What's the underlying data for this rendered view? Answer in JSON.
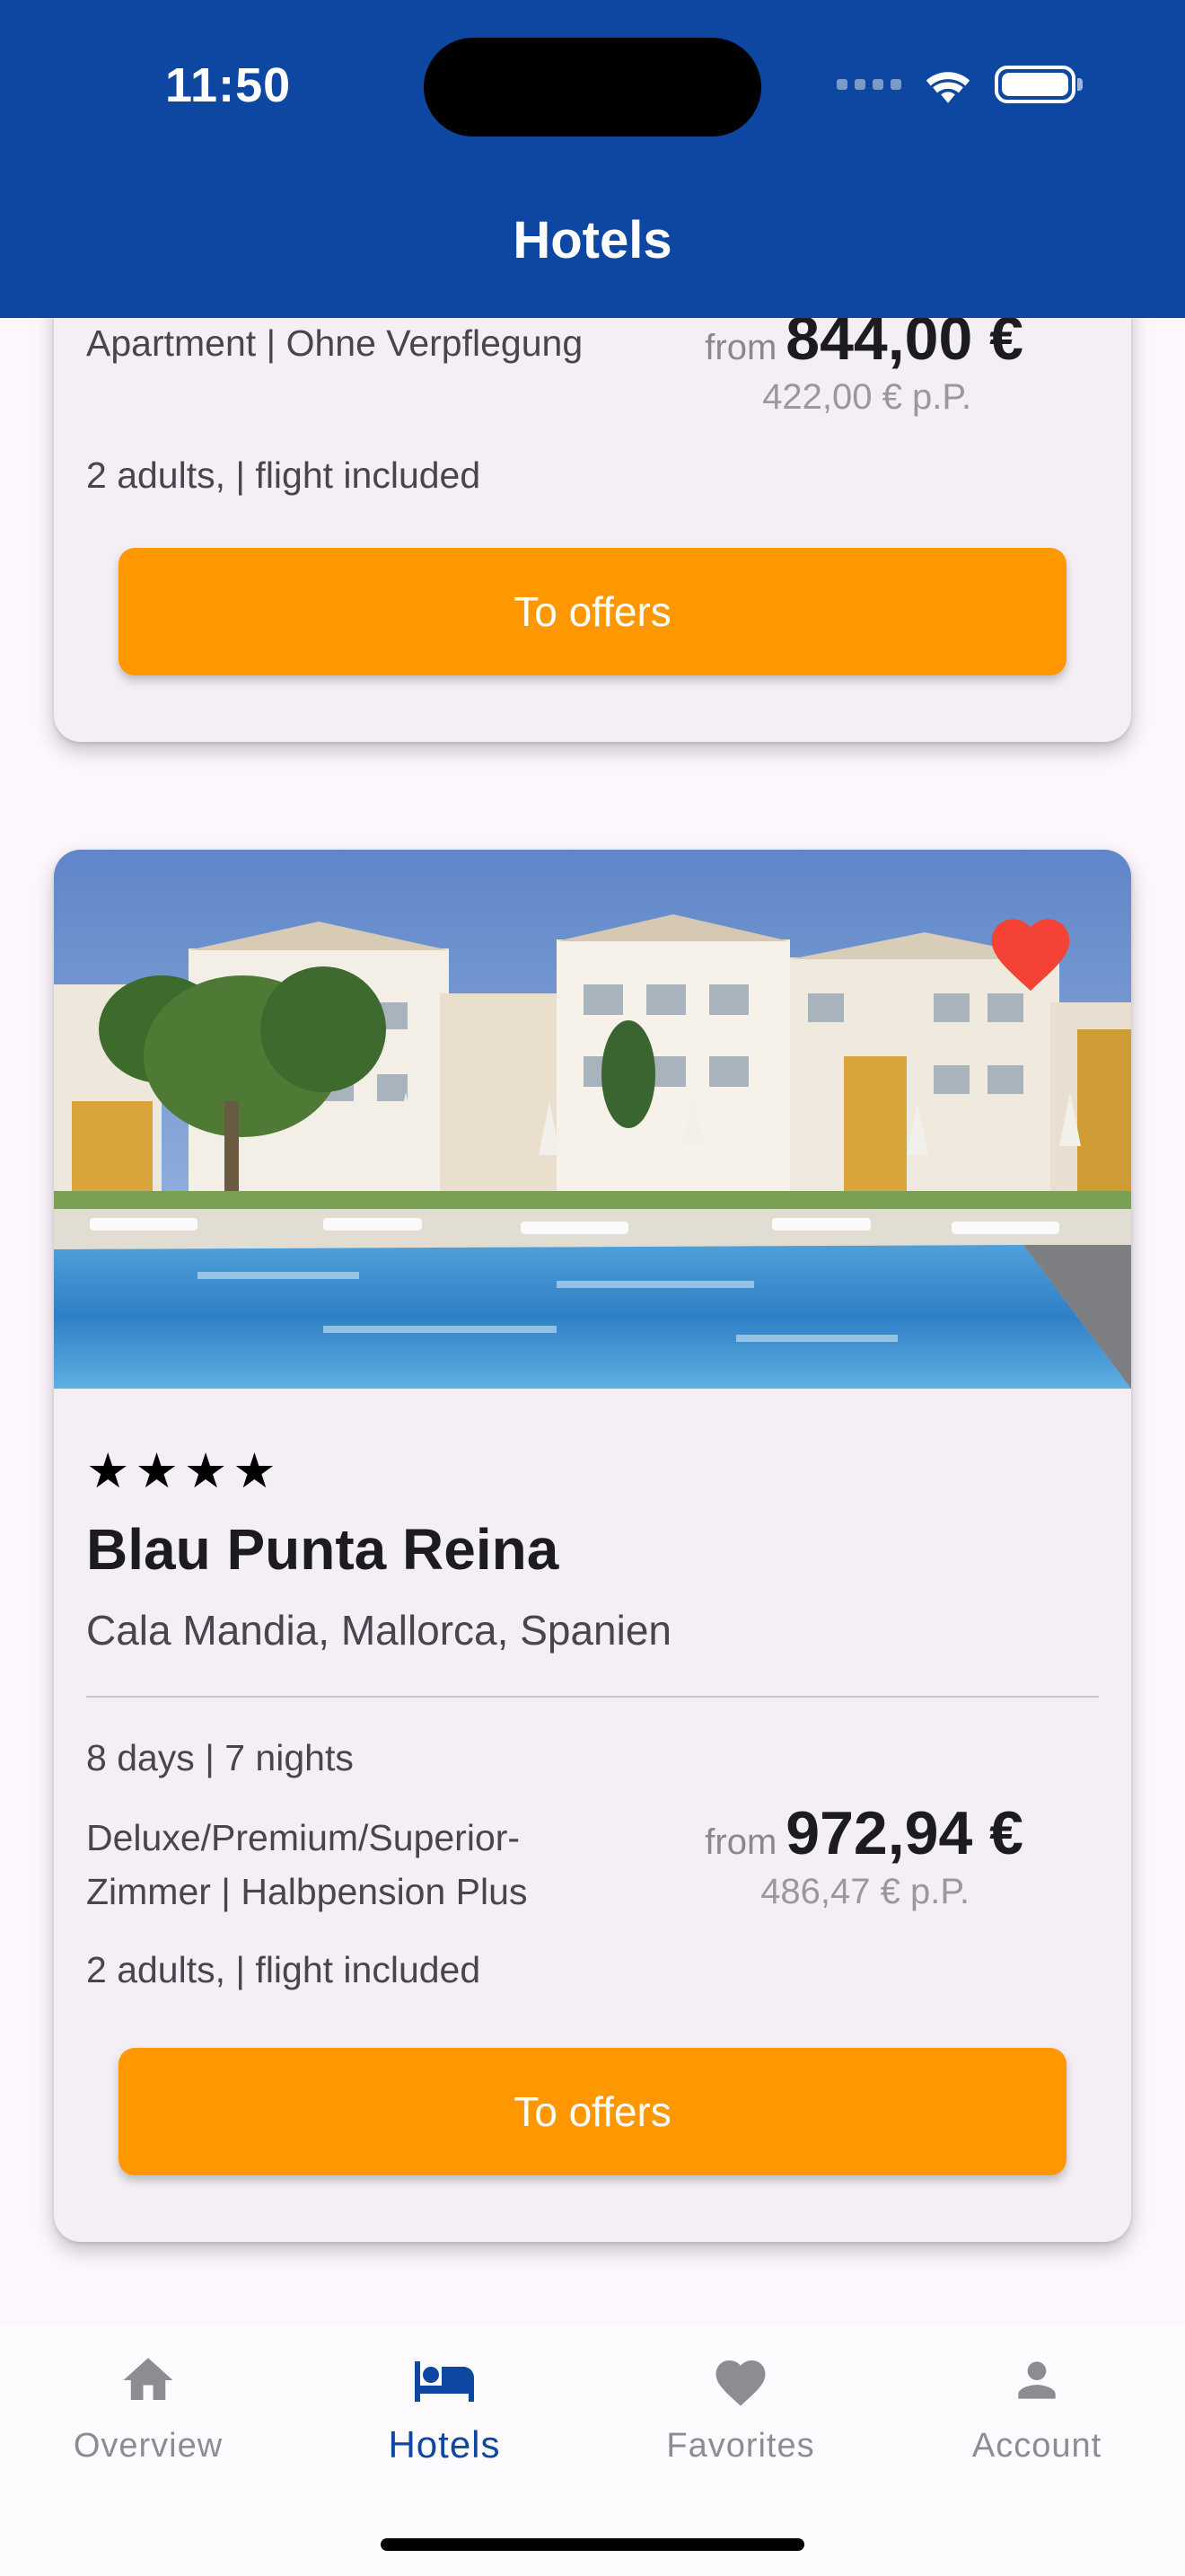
{
  "status_bar": {
    "time": "11:50"
  },
  "app_bar": {
    "title": "Hotels"
  },
  "cards": [
    {
      "room": "Apartment | Ohne Verpflegung",
      "from_label": "from",
      "price": "844,00 €",
      "price_per_person": "422,00 € p.P.",
      "occupancy": "2 adults,  | flight included",
      "button_label": "To offers"
    },
    {
      "stars": "★★★★",
      "rating_stars": 4,
      "favorite": true,
      "name": "Blau Punta Reina",
      "location": "Cala Mandia, Mallorca, Spanien",
      "duration": "8 days | 7 nights",
      "room": "Deluxe/Premium/Superior-Zimmer | Halbpension Plus",
      "from_label": "from",
      "price": "972,94 €",
      "price_per_person": "486,47 € p.P.",
      "occupancy": "2 adults,  | flight included",
      "button_label": "To offers"
    }
  ],
  "bottom_nav": {
    "items": [
      {
        "label": "Overview",
        "icon": "home-icon",
        "active": false
      },
      {
        "label": "Hotels",
        "icon": "bed-icon",
        "active": true
      },
      {
        "label": "Favorites",
        "icon": "heart-icon",
        "active": false
      },
      {
        "label": "Account",
        "icon": "person-icon",
        "active": false
      }
    ]
  },
  "colors": {
    "app_bar": "#0d47a1",
    "button": "#ff9800",
    "favorite": "#f44336",
    "active_nav": "#0d47a1",
    "inactive_nav": "#8e8c92"
  }
}
